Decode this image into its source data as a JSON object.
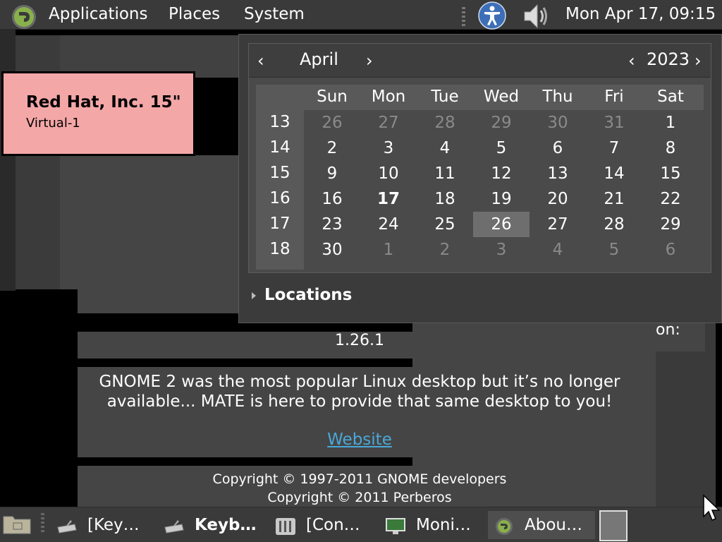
{
  "top_panel": {
    "menus": [
      "Applications",
      "Places",
      "System"
    ],
    "clock": "Mon Apr 17, 09:15",
    "icons": [
      "mate-logo-icon",
      "accessibility-icon",
      "volume-icon"
    ]
  },
  "monitor_label": {
    "name": "Red Hat, Inc. 15\"",
    "output": "Virtual-1",
    "color": "#f4a7a7"
  },
  "calendar": {
    "month": "April",
    "year": "2023",
    "prev_symbol": "‹",
    "next_symbol": "›",
    "weekdays": [
      "Sun",
      "Mon",
      "Tue",
      "Wed",
      "Thu",
      "Fri",
      "Sat"
    ],
    "weeks": [
      {
        "num": "13",
        "days": [
          "26",
          "27",
          "28",
          "29",
          "30",
          "31",
          "1"
        ]
      },
      {
        "num": "14",
        "days": [
          "2",
          "3",
          "4",
          "5",
          "6",
          "7",
          "8"
        ]
      },
      {
        "num": "15",
        "days": [
          "9",
          "10",
          "11",
          "12",
          "13",
          "14",
          "15"
        ]
      },
      {
        "num": "16",
        "days": [
          "16",
          "17",
          "18",
          "19",
          "20",
          "21",
          "22"
        ]
      },
      {
        "num": "17",
        "days": [
          "23",
          "24",
          "25",
          "26",
          "27",
          "28",
          "29"
        ]
      },
      {
        "num": "18",
        "days": [
          "30",
          "1",
          "2",
          "3",
          "4",
          "5",
          "6"
        ]
      }
    ],
    "today": "17",
    "selected": "26",
    "locations_label": "Locations"
  },
  "about": {
    "version": "1.26.1",
    "description_line1": "GNOME 2 was the most popular Linux desktop but it’s no longer",
    "description_line2": "available... MATE is here to provide that same desktop to you!",
    "website_label": "Website",
    "copyright1": "Copyright © 1997-2011 GNOME developers",
    "copyright2": "Copyright © 2011 Perberos",
    "partial_label": "on:"
  },
  "taskbar": {
    "tasks": [
      {
        "label": "[Key…",
        "icon": "keyboard-icon",
        "bold": false,
        "active": false
      },
      {
        "label": "Keyb…",
        "icon": "keyboard-icon",
        "bold": true,
        "active": false
      },
      {
        "label": "[Con…",
        "icon": "control-center-icon",
        "bold": false,
        "active": false
      },
      {
        "label": "Moni…",
        "icon": "monitor-icon",
        "bold": false,
        "active": false
      },
      {
        "label": "Abou…",
        "icon": "mate-logo-icon",
        "bold": false,
        "active": true
      }
    ]
  },
  "colors": {
    "panel": "#3a3a3a",
    "link": "#4aa8d8"
  }
}
